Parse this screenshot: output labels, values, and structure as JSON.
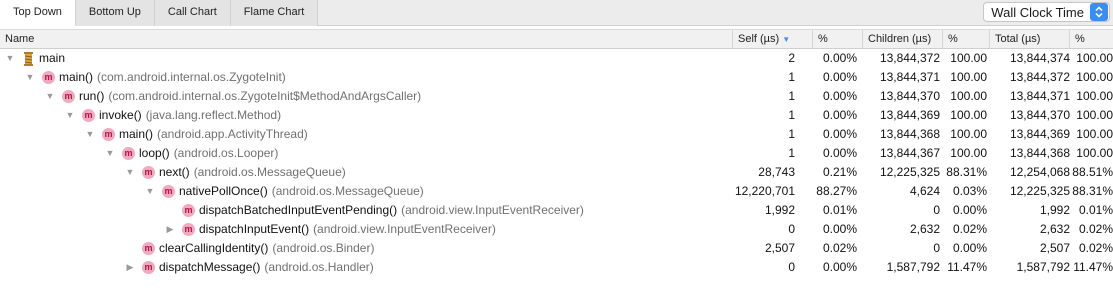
{
  "tabs": [
    "Top Down",
    "Bottom Up",
    "Call Chart",
    "Flame Chart"
  ],
  "clock": {
    "selected": "Wall Clock Time"
  },
  "columns": {
    "name": "Name",
    "self": "Self (µs)",
    "self_pct": "%",
    "children": "Children (µs)",
    "children_pct": "%",
    "total": "Total (µs)",
    "total_pct": "%"
  },
  "rows": [
    {
      "method": "main",
      "cls": "",
      "icon": "thread",
      "expand": "down",
      "depth": 0,
      "self": "2",
      "self_pct": "0.00%",
      "children": "13,844,372",
      "children_pct": "100.00",
      "total": "13,844,374",
      "total_pct": "100.00"
    },
    {
      "method": "main()",
      "cls": "(com.android.internal.os.ZygoteInit)",
      "icon": "m",
      "expand": "down",
      "depth": 1,
      "self": "1",
      "self_pct": "0.00%",
      "children": "13,844,371",
      "children_pct": "100.00",
      "total": "13,844,372",
      "total_pct": "100.00"
    },
    {
      "method": "run()",
      "cls": "(com.android.internal.os.ZygoteInit$MethodAndArgsCaller)",
      "icon": "m",
      "expand": "down",
      "depth": 2,
      "self": "1",
      "self_pct": "0.00%",
      "children": "13,844,370",
      "children_pct": "100.00",
      "total": "13,844,371",
      "total_pct": "100.00"
    },
    {
      "method": "invoke()",
      "cls": "(java.lang.reflect.Method)",
      "icon": "m",
      "expand": "down",
      "depth": 3,
      "self": "1",
      "self_pct": "0.00%",
      "children": "13,844,369",
      "children_pct": "100.00",
      "total": "13,844,370",
      "total_pct": "100.00"
    },
    {
      "method": "main()",
      "cls": "(android.app.ActivityThread)",
      "icon": "m",
      "expand": "down",
      "depth": 4,
      "self": "1",
      "self_pct": "0.00%",
      "children": "13,844,368",
      "children_pct": "100.00",
      "total": "13,844,369",
      "total_pct": "100.00"
    },
    {
      "method": "loop()",
      "cls": "(android.os.Looper)",
      "icon": "m",
      "expand": "down",
      "depth": 5,
      "self": "1",
      "self_pct": "0.00%",
      "children": "13,844,367",
      "children_pct": "100.00",
      "total": "13,844,368",
      "total_pct": "100.00"
    },
    {
      "method": "next()",
      "cls": "(android.os.MessageQueue)",
      "icon": "m",
      "expand": "down",
      "depth": 6,
      "self": "28,743",
      "self_pct": "0.21%",
      "children": "12,225,325",
      "children_pct": "88.31%",
      "total": "12,254,068",
      "total_pct": "88.51%"
    },
    {
      "method": "nativePollOnce()",
      "cls": "(android.os.MessageQueue)",
      "icon": "m",
      "expand": "down",
      "depth": 7,
      "self": "12,220,701",
      "self_pct": "88.27%",
      "children": "4,624",
      "children_pct": "0.03%",
      "total": "12,225,325",
      "total_pct": "88.31%"
    },
    {
      "method": "dispatchBatchedInputEventPending()",
      "cls": "(android.view.InputEventReceiver)",
      "icon": "m",
      "expand": "none",
      "depth": 8,
      "self": "1,992",
      "self_pct": "0.01%",
      "children": "0",
      "children_pct": "0.00%",
      "total": "1,992",
      "total_pct": "0.01%"
    },
    {
      "method": "dispatchInputEvent()",
      "cls": "(android.view.InputEventReceiver)",
      "icon": "m",
      "expand": "right",
      "depth": 8,
      "self": "0",
      "self_pct": "0.00%",
      "children": "2,632",
      "children_pct": "0.02%",
      "total": "2,632",
      "total_pct": "0.02%"
    },
    {
      "method": "clearCallingIdentity()",
      "cls": "(android.os.Binder)",
      "icon": "m",
      "expand": "none",
      "depth": 6,
      "self": "2,507",
      "self_pct": "0.02%",
      "children": "0",
      "children_pct": "0.00%",
      "total": "2,507",
      "total_pct": "0.02%"
    },
    {
      "method": "dispatchMessage()",
      "cls": "(android.os.Handler)",
      "icon": "m",
      "expand": "right",
      "depth": 6,
      "self": "0",
      "self_pct": "0.00%",
      "children": "1,587,792",
      "children_pct": "11.47%",
      "total": "1,587,792",
      "total_pct": "11.47%"
    }
  ]
}
